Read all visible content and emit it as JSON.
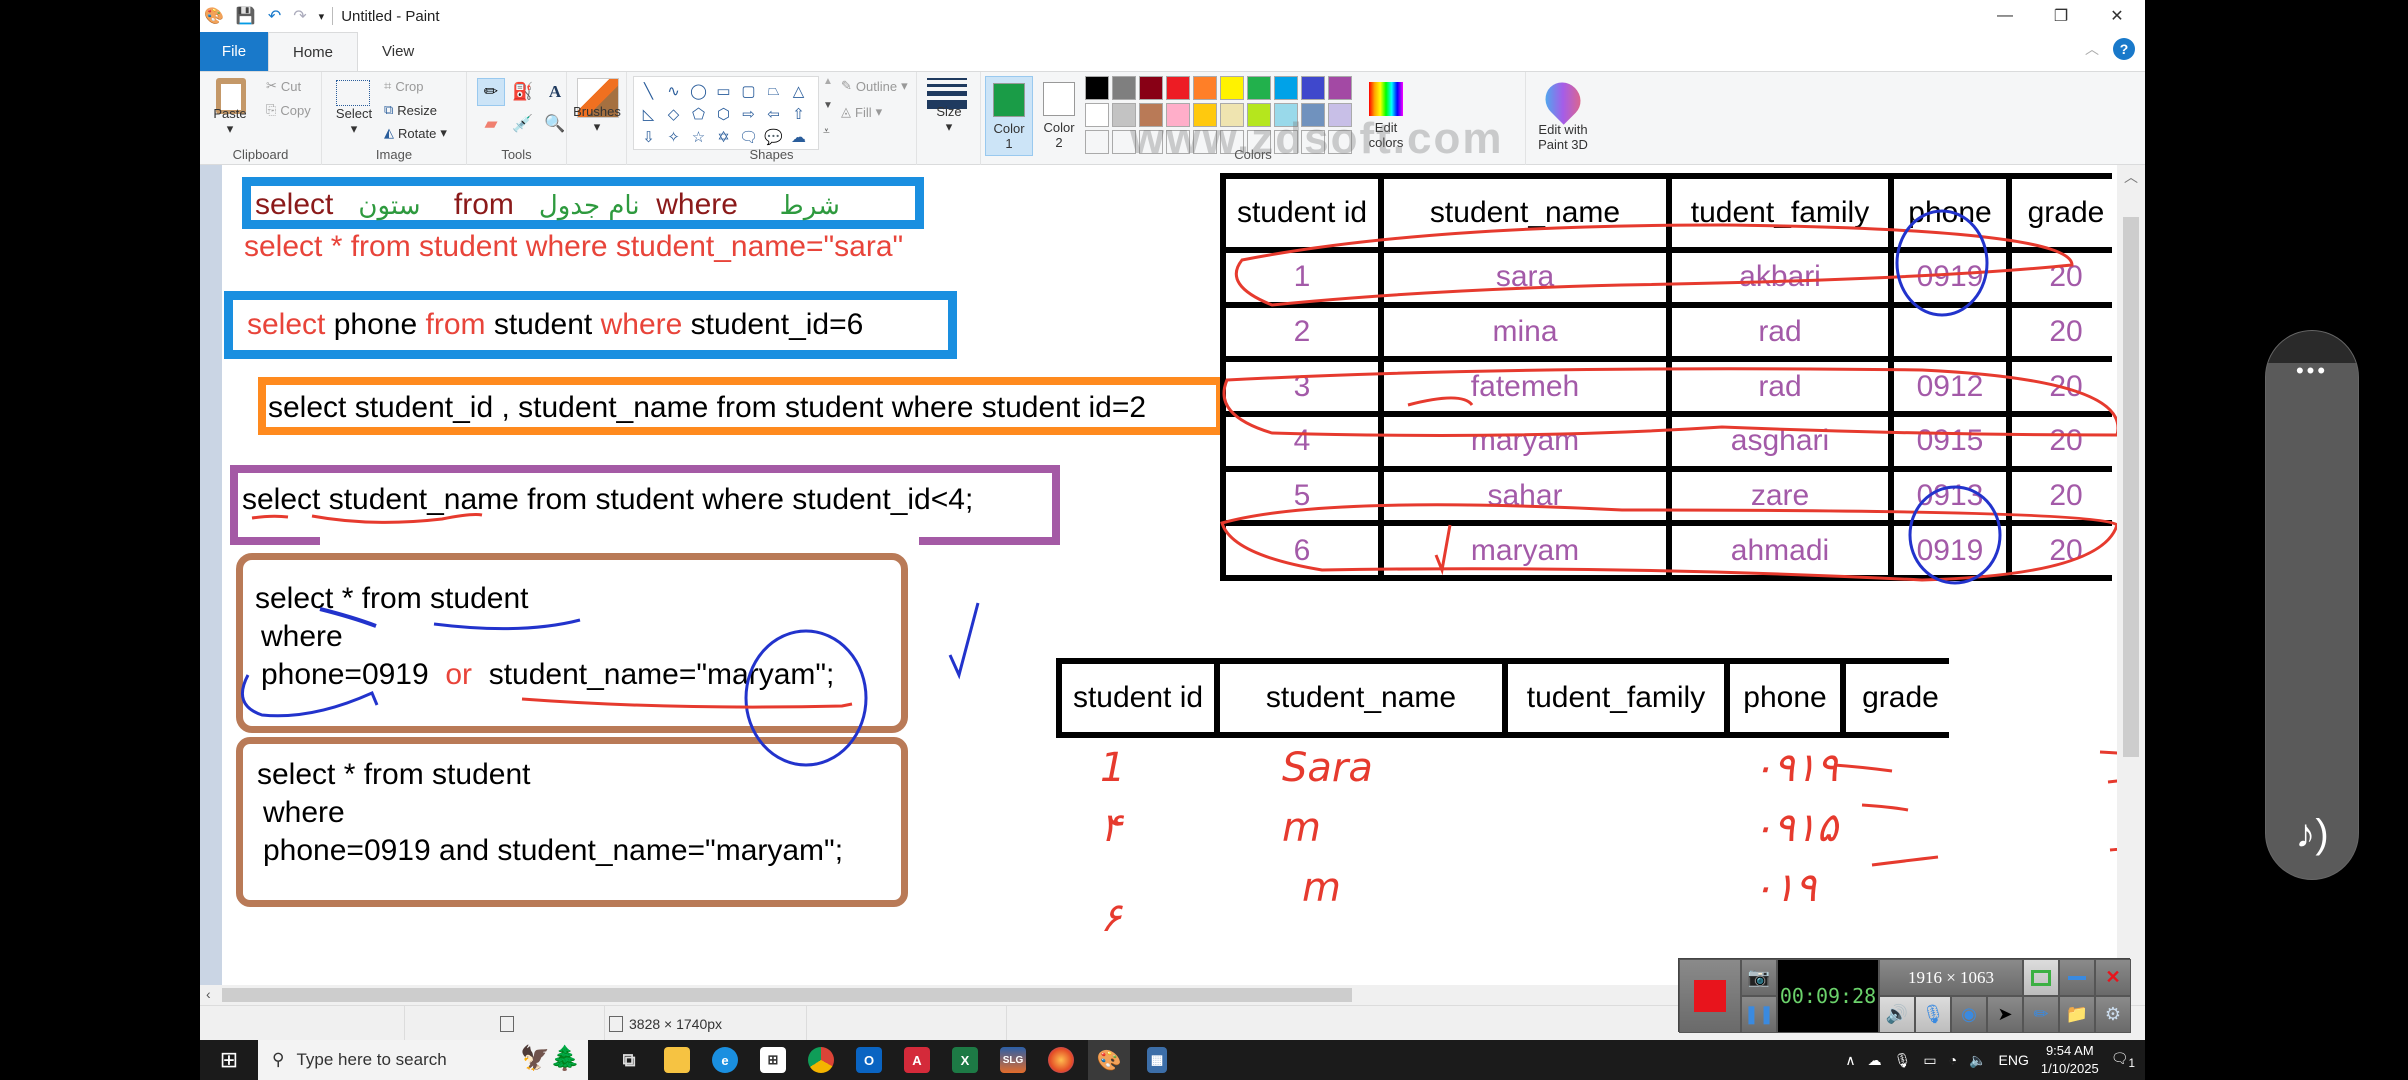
{
  "window": {
    "title": "Untitled - Paint",
    "controls": {
      "minimize": "—",
      "maximize": "❐",
      "close": "✕"
    }
  },
  "tabs": [
    {
      "label": "File"
    },
    {
      "label": "Home",
      "active": true
    },
    {
      "label": "View"
    }
  ],
  "help_label": "?",
  "ribbon": {
    "clipboard": {
      "group": "Clipboard",
      "paste": "Paste",
      "cut": "Cut",
      "copy": "Copy"
    },
    "image": {
      "group": "Image",
      "select": "Select",
      "crop": "Crop",
      "resize": "Resize",
      "rotate": "Rotate"
    },
    "tools": {
      "group": "Tools"
    },
    "brushes": {
      "label": "Brushes"
    },
    "shapes": {
      "group": "Shapes",
      "outline": "Outline",
      "fill": "Fill"
    },
    "size": {
      "label": "Size"
    },
    "colors": {
      "group": "Colors",
      "color1_label": "Color",
      "color1_num": "1",
      "color2_label": "Color",
      "color2_num": "2",
      "color1": "#1a9c47",
      "color2": "#ffffff",
      "palette": [
        "#000000",
        "#7f7f7f",
        "#880015",
        "#ed1c24",
        "#ff7f27",
        "#fff200",
        "#22b14c",
        "#00a2e8",
        "#3f48cc",
        "#a349a4",
        "#ffffff",
        "#c3c3c3",
        "#b97a57",
        "#ffaec9",
        "#ffc90e",
        "#efe4b0",
        "#b5e61d",
        "#99d9ea",
        "#7092be",
        "#c8bfe7",
        "",
        "",
        "",
        "",
        "",
        "",
        "",
        "",
        "",
        ""
      ],
      "edit_colors": "Edit colors"
    },
    "paint3d": "Edit with Paint 3D",
    "watermark": "www.zdsoft.com"
  },
  "canvas": {
    "syntax_box": {
      "select": "select",
      "column_fa": "ستون",
      "from": "from",
      "table_fa": "نام جدول",
      "where": "where",
      "condition_fa": "شرط"
    },
    "query1": "select * from student where student_name=\"sara\"",
    "query2": {
      "select": "select",
      "col": "phone",
      "from": "from",
      "table": "student",
      "where": "where",
      "cond": "student_id=6"
    },
    "query3": "select student_id , student_name from student where student id=2",
    "query4": "select student_name from student where student_id<4;",
    "query5": {
      "line1": "select * from student",
      "line2": "where",
      "cond_a": "phone=0919",
      "op": "or",
      "cond_b": "student_name=\"maryam\";"
    },
    "query6": {
      "line1": "select * from student",
      "line2": "where",
      "line3": "phone=0919 and student_name=\"maryam\";"
    },
    "main_table": {
      "headers": [
        "student id",
        "student_name",
        "tudent_family",
        "phone",
        "grade"
      ],
      "rows": [
        [
          "1",
          "sara",
          "akbari",
          "0919",
          "20"
        ],
        [
          "2",
          "mina",
          "rad",
          "",
          "20"
        ],
        [
          "3",
          "fatemeh",
          "rad",
          "0912",
          "20"
        ],
        [
          "4",
          "maryam",
          "asghari",
          "0915",
          "20"
        ],
        [
          "5",
          "sahar",
          "zare",
          "0913",
          "20"
        ],
        [
          "6",
          "maryam",
          "ahmadi",
          "0919",
          "20"
        ]
      ]
    },
    "result_table": {
      "headers": [
        "student id",
        "student_name",
        "tudent_family",
        "phone",
        "grade"
      ],
      "handwritten": {
        "ids": [
          "1",
          "۴",
          "۶"
        ],
        "names": [
          "Sara",
          "m",
          "m"
        ],
        "phones": [
          "۰۹۱۹",
          "۰۹۱۵",
          "۰۱۹"
        ]
      }
    }
  },
  "statusbar": {
    "dimensions": "3828 × 1740px"
  },
  "recorder": {
    "time": "00:09:28",
    "resolution": "1916 × 1063"
  },
  "taskbar": {
    "search_placeholder": "Type here to search",
    "apps": [
      "Task View",
      "File Explorer",
      "Edge",
      "Microsoft Store",
      "Chrome",
      "Outlook",
      "AutoCAD",
      "Excel",
      "SLG",
      "Firefox",
      "Paint",
      "Calculator"
    ],
    "language": "ENG",
    "time": "9:54 AM",
    "date": "1/10/2025",
    "notifications": "1"
  }
}
